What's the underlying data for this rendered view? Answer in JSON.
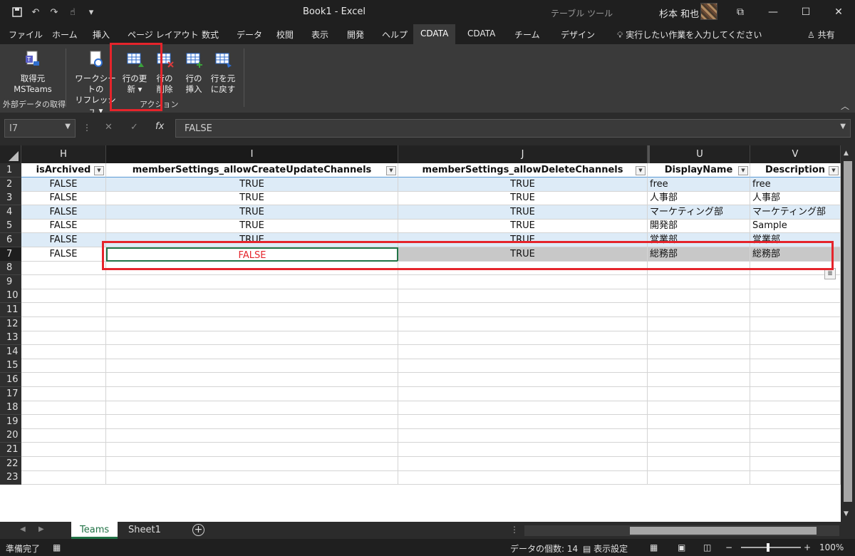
{
  "window": {
    "title": "Book1 - Excel",
    "context_tab": "テーブル ツール",
    "user": "杉本 和也",
    "controls": [
      "⧉",
      "—",
      "☐",
      "✕"
    ]
  },
  "menu": {
    "tabs": [
      "ファイル",
      "ホーム",
      "挿入",
      "ページ レイアウト",
      "数式",
      "データ",
      "校閲",
      "表示",
      "開発",
      "ヘルプ",
      "CDATA",
      "CDATA",
      "チーム",
      "デザイン"
    ],
    "tellme": "実行したい作業を入力してください",
    "share": "共有"
  },
  "ribbon": {
    "get_source": {
      "line1": "取得元",
      "line2": "MSTeams"
    },
    "group_external": "外部データの取得",
    "refresh": {
      "line1": "ワークシートの",
      "line2": "リフレッシュ ▾"
    },
    "update_row": {
      "line1": "行の更",
      "line2": "新 ▾"
    },
    "delete_row": {
      "line1": "行の",
      "line2": "削除"
    },
    "insert_row": {
      "line1": "行の",
      "line2": "挿入"
    },
    "revert_row": {
      "line1": "行を元",
      "line2": "に戻す"
    },
    "group_action": "アクション"
  },
  "formula_bar": {
    "name_box": "I7",
    "fx": "fx",
    "value": "FALSE"
  },
  "grid": {
    "columns": [
      "H",
      "I",
      "J",
      "U",
      "V"
    ],
    "headers": [
      "isArchived",
      "memberSettings_allowCreateUpdateChannels",
      "memberSettings_allowDeleteChannels",
      "DisplayName",
      "Description"
    ],
    "rows": [
      [
        "FALSE",
        "TRUE",
        "TRUE",
        "free",
        "free"
      ],
      [
        "FALSE",
        "TRUE",
        "TRUE",
        "人事部",
        "人事部"
      ],
      [
        "FALSE",
        "TRUE",
        "TRUE",
        "マーケティング部",
        "マーケティング部"
      ],
      [
        "FALSE",
        "TRUE",
        "TRUE",
        "開発部",
        "Sample"
      ],
      [
        "FALSE",
        "TRUE",
        "TRUE",
        "営業部",
        "営業部"
      ],
      [
        "FALSE",
        "FALSE",
        "TRUE",
        "総務部",
        "総務部"
      ]
    ],
    "row_numbers": [
      "1",
      "2",
      "3",
      "4",
      "5",
      "6",
      "7",
      "8",
      "9",
      "10",
      "11",
      "12",
      "13",
      "14",
      "15",
      "16",
      "17",
      "18",
      "19",
      "20",
      "21",
      "22",
      "23"
    ],
    "edited_color": "#e5242b",
    "highlight_color": "#e5242b"
  },
  "sheets": {
    "tabs": [
      "Teams",
      "Sheet1"
    ],
    "active": "Teams"
  },
  "status": {
    "ready": "準備完了",
    "count": "データの個数: 14",
    "display_settings": "表示設定",
    "zoom": "100%"
  }
}
